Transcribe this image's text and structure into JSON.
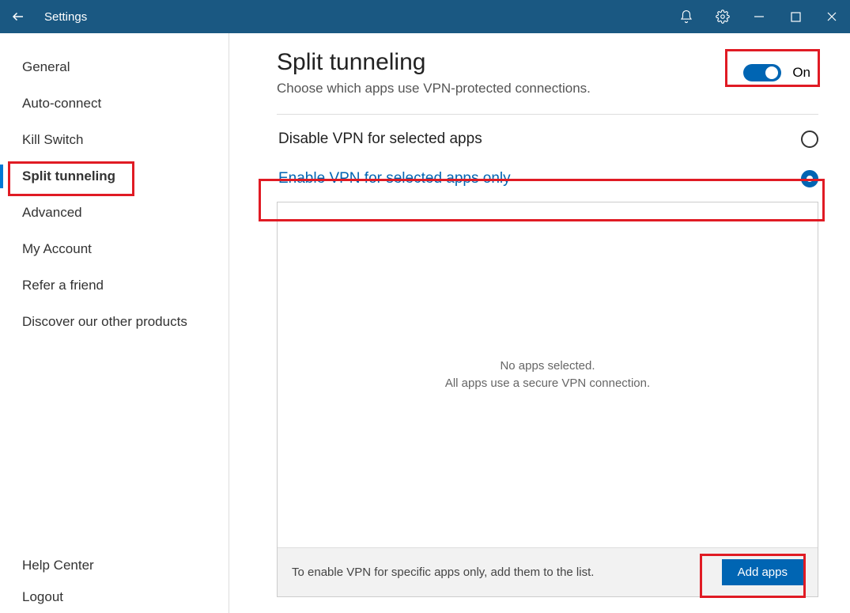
{
  "titlebar": {
    "title": "Settings"
  },
  "sidebar": {
    "items": [
      {
        "label": "General"
      },
      {
        "label": "Auto-connect"
      },
      {
        "label": "Kill Switch"
      },
      {
        "label": "Split tunneling"
      },
      {
        "label": "Advanced"
      },
      {
        "label": "My Account"
      },
      {
        "label": "Refer a friend"
      },
      {
        "label": "Discover our other products"
      }
    ],
    "selectedIndex": 3,
    "bottom": [
      {
        "label": "Help Center"
      },
      {
        "label": "Logout"
      }
    ]
  },
  "content": {
    "heading": "Split tunneling",
    "subheading": "Choose which apps use VPN-protected connections.",
    "toggle": {
      "on": true,
      "label": "On"
    },
    "options": [
      {
        "label": "Disable VPN for selected apps",
        "selected": false
      },
      {
        "label": "Enable VPN for selected apps only",
        "selected": true
      }
    ],
    "panel": {
      "emptyLine1": "No apps selected.",
      "emptyLine2": "All apps use a secure VPN connection.",
      "footerText": "To enable VPN for specific apps only, add them to the list.",
      "addButton": "Add apps"
    }
  }
}
